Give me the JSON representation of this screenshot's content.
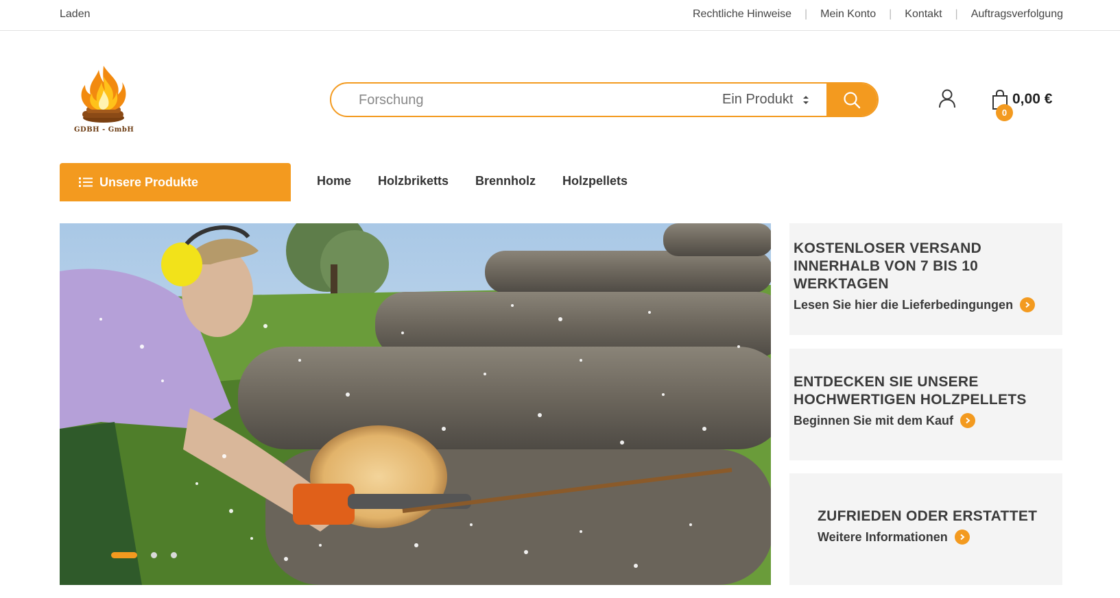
{
  "topbar": {
    "shop_label": "Laden",
    "links": [
      "Rechtliche Hinweise",
      "Mein Konto",
      "Kontakt",
      "Auftragsverfolgung"
    ],
    "separator": "|"
  },
  "header": {
    "logo_text": "GDBH - GmbH",
    "search": {
      "placeholder": "Forschung",
      "category": "Ein Produkt"
    },
    "cart": {
      "count": "0",
      "total": "0,00 €"
    }
  },
  "nav": {
    "category_button": "Unsere Produkte",
    "items": [
      "Home",
      "Holzbriketts",
      "Brennholz",
      "Holzpellets"
    ]
  },
  "hero": {
    "slide_count": 3,
    "active_slide": 1
  },
  "promos": [
    {
      "title": "KOSTENLOSER VERSAND INNERHALB VON 7 BIS 10 WERKTAGEN",
      "link": "Lesen Sie hier die Lieferbedingungen"
    },
    {
      "title": "ENTDECKEN SIE UNSERE HOCHWERTIGEN HOLZPELLETS",
      "link": "Beginnen Sie mit dem Kauf"
    },
    {
      "title": "ZUFRIEDEN ODER ERSTATTET",
      "link": "Weitere Informationen"
    }
  ],
  "colors": {
    "accent": "#f39a1f",
    "card_bg": "#f4f4f4",
    "text_dark": "#3a3a3a"
  }
}
